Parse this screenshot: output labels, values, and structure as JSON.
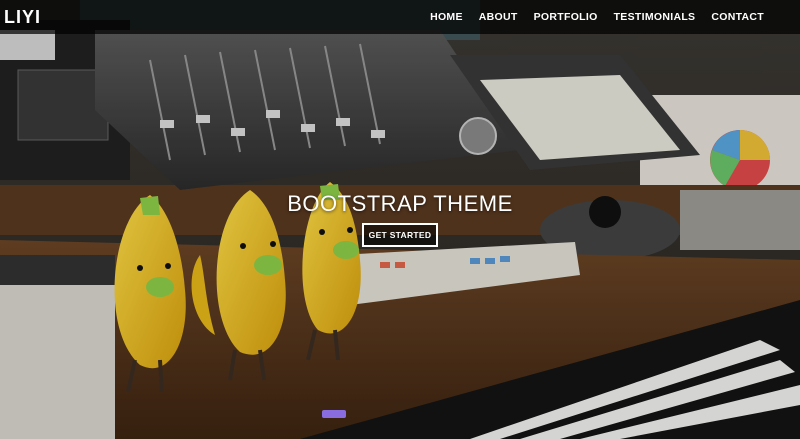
{
  "navbar": {
    "brand": "LIYI",
    "links": [
      "HOME",
      "ABOUT",
      "PORTFOLIO",
      "TESTIMONIALS",
      "CONTACT"
    ]
  },
  "hero": {
    "title": "BOOTSTRAP THEME",
    "cta_label": "GET STARTED",
    "background": "photo of music studio desk with mixing controllers, keyboard and banana-duck figurines"
  },
  "colors": {
    "navbar_bg": "#000000",
    "text": "#ffffff",
    "figurine_yellow": "#f2c61a",
    "beak_green": "#8fce4a"
  }
}
